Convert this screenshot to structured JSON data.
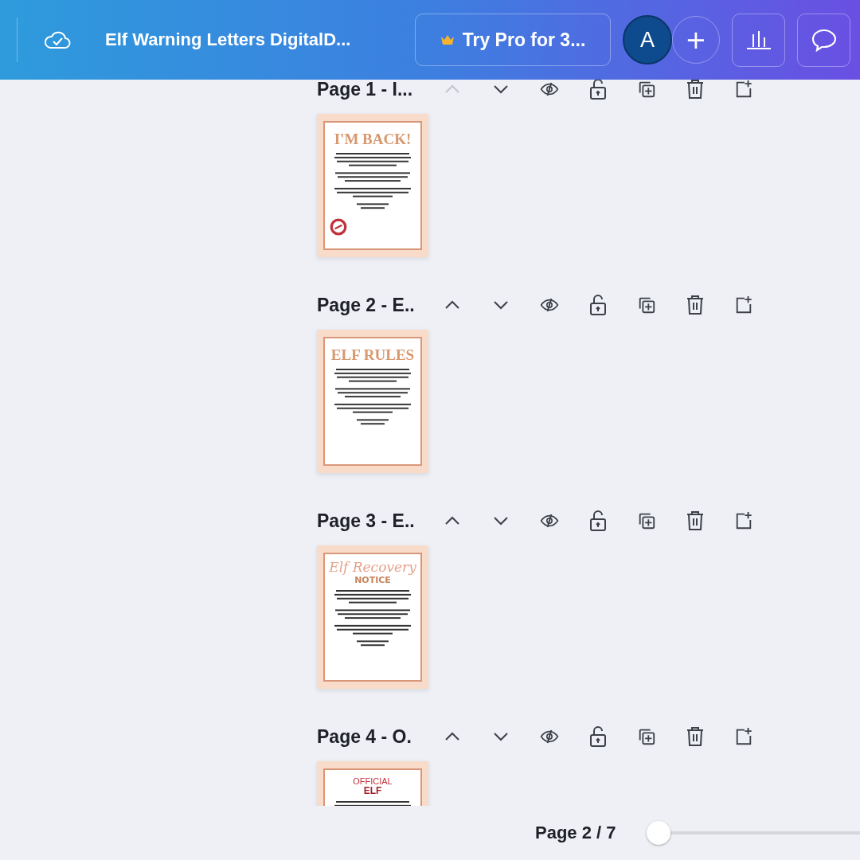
{
  "topbar": {
    "title": "Elf Warning Letters DigitalD...",
    "pro_button": "Try Pro for 3...",
    "avatar": "A",
    "add_button": "+"
  },
  "pages": [
    {
      "label": "Page 1 - I...",
      "up_disabled": true,
      "thumb": {
        "texts": [
          {
            "text": "I'M BACK!",
            "kind": "headline"
          }
        ],
        "stamp": true
      }
    },
    {
      "label": "Page 2 - E..",
      "up_disabled": false,
      "thumb": {
        "texts": [
          {
            "text": "ELF RULES",
            "kind": "headline"
          }
        ],
        "stamp": false
      }
    },
    {
      "label": "Page 3 - E..",
      "up_disabled": false,
      "thumb": {
        "texts": [
          {
            "text": "Elf Recovery",
            "kind": "script"
          },
          {
            "text": "NOTICE",
            "kind": "block"
          }
        ],
        "stamp": false
      }
    },
    {
      "label": "Page 4 - O.",
      "up_disabled": false,
      "thumb": {
        "texts": [
          {
            "text": "OFFICIAL",
            "kind": "red"
          },
          {
            "text": "ELF",
            "kind": "redbold"
          }
        ],
        "stamp": false
      }
    }
  ],
  "footer": {
    "page_indicator": "Page 2 / 7",
    "slider": {
      "level": 0
    }
  }
}
